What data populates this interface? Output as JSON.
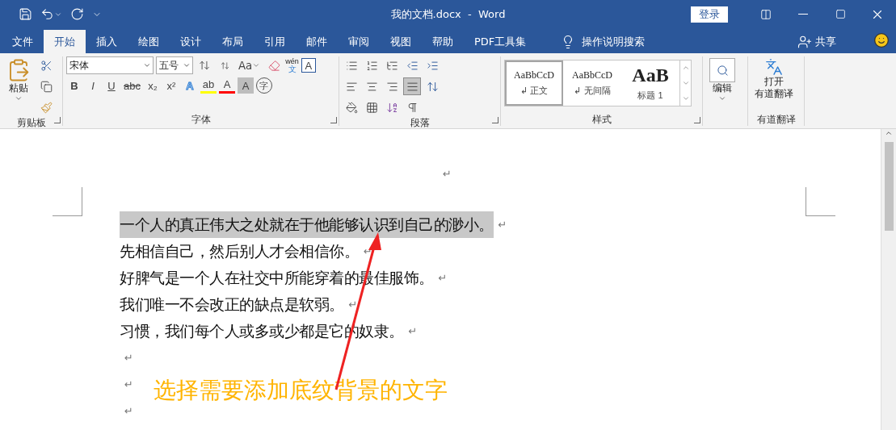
{
  "window": {
    "title": "我的文档.docx  -  Word",
    "login": "登录"
  },
  "tabs": [
    {
      "label": "文件",
      "selected": false
    },
    {
      "label": "开始",
      "selected": true
    },
    {
      "label": "插入",
      "selected": false
    },
    {
      "label": "绘图",
      "selected": false
    },
    {
      "label": "设计",
      "selected": false
    },
    {
      "label": "布局",
      "selected": false
    },
    {
      "label": "引用",
      "selected": false
    },
    {
      "label": "邮件",
      "selected": false
    },
    {
      "label": "审阅",
      "selected": false
    },
    {
      "label": "视图",
      "selected": false
    },
    {
      "label": "帮助",
      "selected": false
    },
    {
      "label": "PDF工具集",
      "selected": false
    }
  ],
  "tell_me": "操作说明搜索",
  "share": "共享",
  "ribbon": {
    "clipboard": {
      "paste": "粘贴",
      "label": "剪贴板"
    },
    "font": {
      "name": "宋体",
      "size": "五号",
      "case": "Aa",
      "phonetic_top": "wén",
      "phonetic_bottom": "文",
      "boxed": "A",
      "label": "字体",
      "format": [
        {
          "glyph": "B",
          "kind": "bold"
        },
        {
          "glyph": "I",
          "kind": "italic"
        },
        {
          "glyph": "U",
          "kind": "underline"
        },
        {
          "glyph": "abc",
          "kind": "strike"
        },
        {
          "glyph": "x₂",
          "kind": "plain"
        },
        {
          "glyph": "x²",
          "kind": "plain"
        }
      ],
      "effects": [
        {
          "glyph": "A",
          "kind": "outline"
        },
        {
          "glyph": "ab",
          "kind": "highlight"
        },
        {
          "glyph": "A",
          "kind": "color"
        },
        {
          "glyph": "A",
          "kind": "shade"
        },
        {
          "glyph": "字",
          "kind": "circle"
        }
      ]
    },
    "paragraph": {
      "label": "段落",
      "justify_selected": true
    },
    "styles": {
      "label": "样式",
      "items": [
        {
          "preview": "AaBbCcD",
          "name": "↲ 正文",
          "kind": "normal",
          "selected": true
        },
        {
          "preview": "AaBbCcD",
          "name": "↲ 无间隔",
          "kind": "normal",
          "selected": false
        },
        {
          "preview": "AaB",
          "name": "标题 1",
          "kind": "heading",
          "selected": false
        }
      ]
    },
    "editing": {
      "label": "编辑"
    },
    "translate": {
      "button": [
        "打开",
        "有道翻译"
      ],
      "label": "有道翻译"
    }
  },
  "document": {
    "top_mark": "↵",
    "lines": [
      {
        "text": "一个人的真正伟大之处就在于他能够认识到自己的渺小。",
        "mark": "↵",
        "selected": true
      },
      {
        "text": "先相信自己，然后别人才会相信你。",
        "mark": "↵",
        "selected": false
      },
      {
        "text": "好脾气是一个人在社交中所能穿着的最佳服饰。",
        "mark": "↵",
        "selected": false
      },
      {
        "text": "我们唯一不会改正的缺点是软弱。",
        "mark": "↵",
        "selected": false
      },
      {
        "text": "习惯，我们每个人或多或少都是它的奴隶。",
        "mark": "↵",
        "selected": false
      },
      {
        "mark": "↵"
      },
      {
        "mark": "↵"
      },
      {
        "mark": "↵"
      }
    ]
  },
  "annotation": {
    "text": "选择需要添加底纹背景的文字"
  }
}
